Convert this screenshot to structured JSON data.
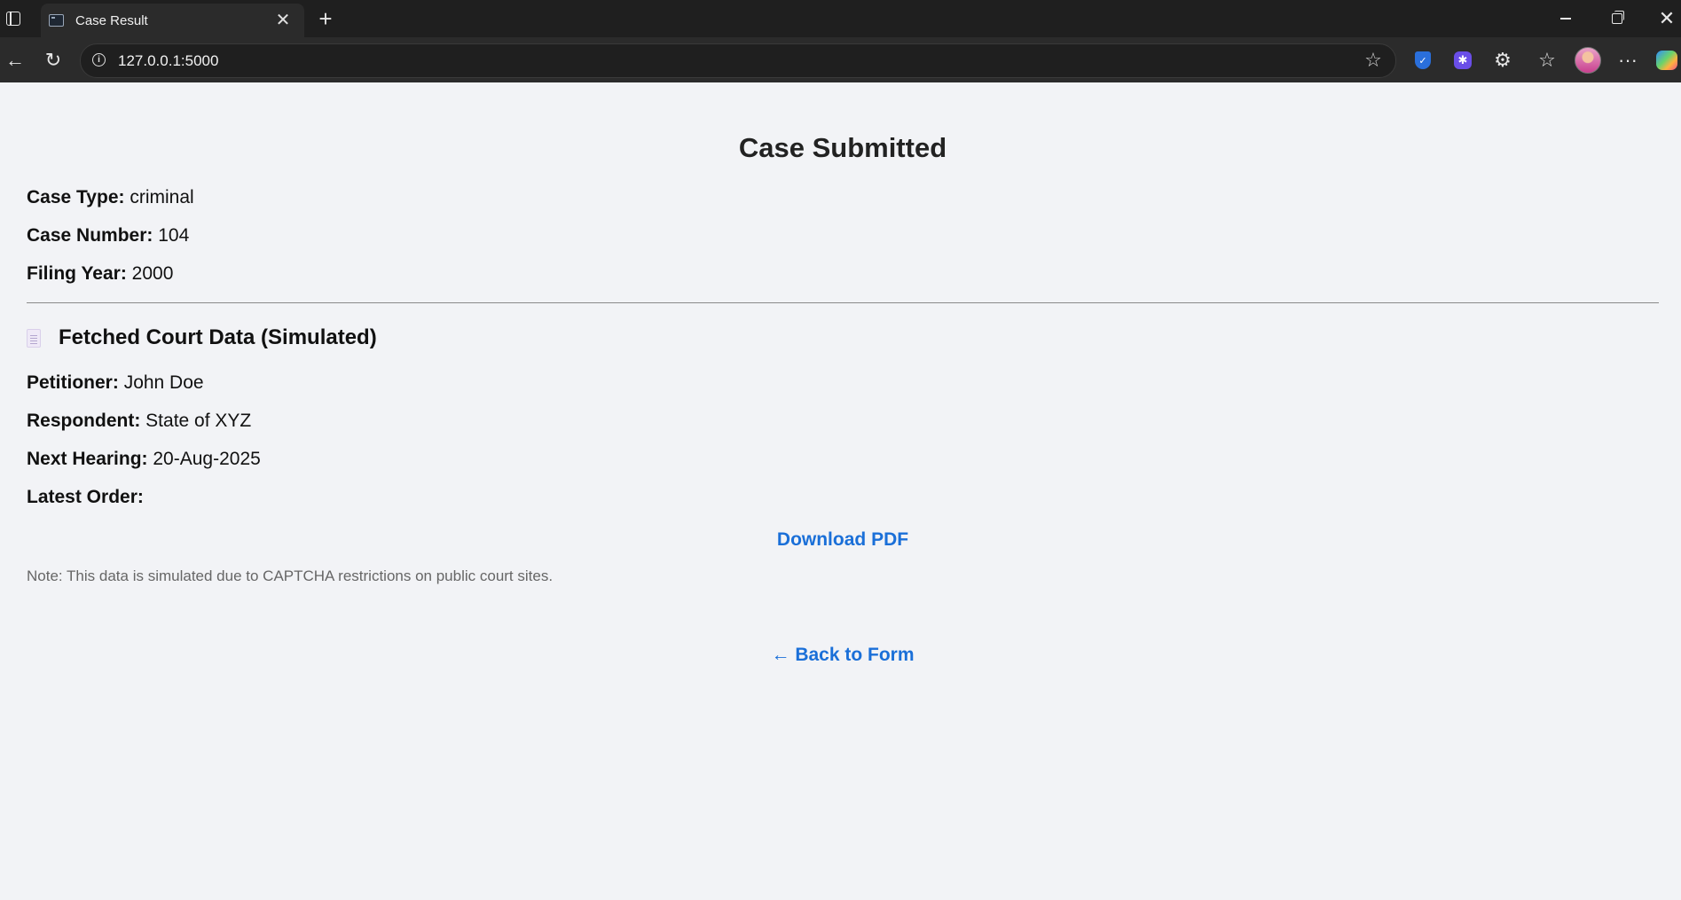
{
  "browser": {
    "tab_title": "Case Result",
    "tab_close": "✕",
    "new_tab": "+",
    "url": "127.0.0.1:5000",
    "back": "←",
    "reload": "↻",
    "star": "☆",
    "extensions": "⚙",
    "favorites": "☆",
    "more": "···",
    "window_close": "✕"
  },
  "page": {
    "heading": "Case Submitted",
    "case_fields": [
      {
        "label": "Case Type:",
        "value": "criminal"
      },
      {
        "label": "Case Number:",
        "value": "104"
      },
      {
        "label": "Filing Year:",
        "value": "2000"
      }
    ],
    "court_section_title": "Fetched Court Data (Simulated)",
    "court_fields": [
      {
        "label": "Petitioner:",
        "value": "John Doe"
      },
      {
        "label": "Respondent:",
        "value": "State of XYZ"
      },
      {
        "label": "Next Hearing:",
        "value": "20-Aug-2025"
      },
      {
        "label": "Latest Order:",
        "value": ""
      }
    ],
    "download_link": "Download PDF",
    "note": "Note: This data is simulated due to CAPTCHA restrictions on public court sites.",
    "back_link": "← Back to Form"
  },
  "colors": {
    "link": "#1a6fd8",
    "page_bg": "#f2f3f6",
    "chrome_dark": "#1f1f1f"
  }
}
